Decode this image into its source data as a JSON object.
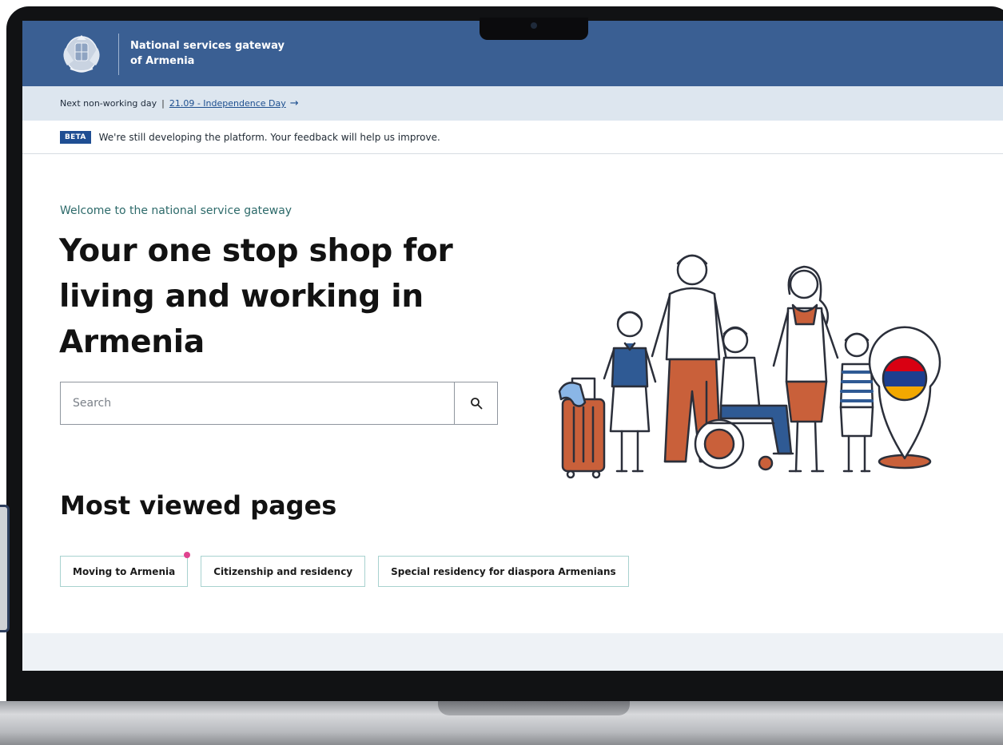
{
  "header": {
    "site_name_line1": "National services gateway",
    "site_name_line2": "of Armenia",
    "background_color": "#3a5f93"
  },
  "non_working_day": {
    "label": "Next non-working day",
    "separator": "|",
    "link_text": "21.09 - Independence Day",
    "arrow": "→"
  },
  "beta": {
    "tag": "BETA",
    "message": "We're still developing the platform. Your feedback will help us improve."
  },
  "hero": {
    "welcome": "Welcome to the national service gateway",
    "title": "Your one stop shop for living and working in Armenia"
  },
  "search": {
    "placeholder": "Search",
    "button_icon": "search-icon"
  },
  "most_viewed": {
    "heading": "Most viewed pages",
    "items": [
      {
        "label": "Moving to Armenia"
      },
      {
        "label": "Citizenship and residency"
      },
      {
        "label": "Special residency for diaspora Armenians"
      }
    ]
  },
  "colors": {
    "accent_teal": "#2d6a6a",
    "beta_blue": "#1f4e93",
    "chip_border": "#a8d2cf",
    "notification_dot": "#e0438f",
    "flag": [
      "#d90012",
      "#0033a0",
      "#f2a800"
    ]
  }
}
